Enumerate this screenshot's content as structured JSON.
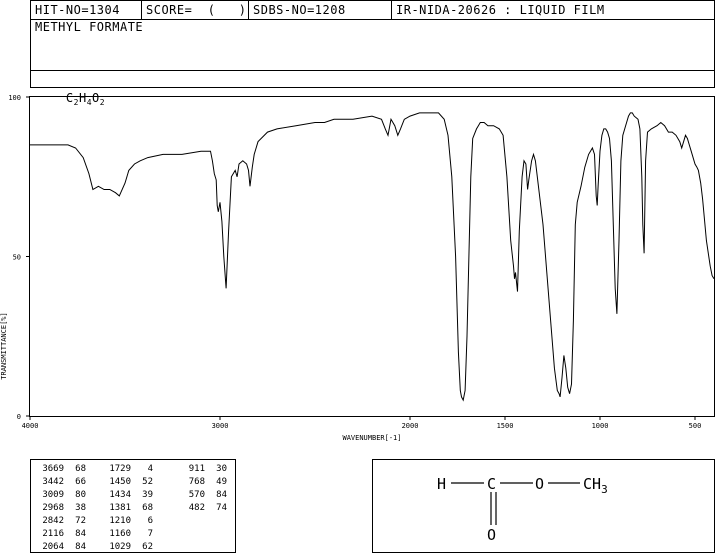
{
  "header": {
    "hit_no": "HIT-NO=1304",
    "score": "SCORE=  (   )",
    "sdbs_no": "SDBS-NO=1208",
    "ir_code": "IR-NIDA-20626 : LIQUID FILM",
    "compound_name": "METHYL FORMATE",
    "formula": {
      "c": "C",
      "c_n": "2",
      "h": "H",
      "h_n": "4",
      "o": "O",
      "o_n": "2"
    }
  },
  "chart_data": {
    "type": "line",
    "xlabel": "WAVENUMBER[-1]",
    "ylabel": "TRANSMITTANCE[%]",
    "xlim": [
      4000,
      400
    ],
    "ylim": [
      0,
      100
    ],
    "x_ticks": [
      4000,
      3000,
      2000,
      1500,
      1000,
      500
    ],
    "y_ticks": [
      0,
      50,
      100
    ],
    "x_tick_labels": [
      "4000",
      "3000",
      "2000",
      "1500",
      "1000",
      "500"
    ],
    "y_tick_labels": [
      "0",
      "50",
      "100"
    ],
    "series": [
      {
        "points": [
          [
            4000,
            85
          ],
          [
            3900,
            85
          ],
          [
            3800,
            85
          ],
          [
            3760,
            84
          ],
          [
            3720,
            81
          ],
          [
            3690,
            76
          ],
          [
            3669,
            71
          ],
          [
            3640,
            72
          ],
          [
            3610,
            71
          ],
          [
            3580,
            71
          ],
          [
            3550,
            70
          ],
          [
            3530,
            69
          ],
          [
            3500,
            73
          ],
          [
            3480,
            77
          ],
          [
            3450,
            79
          ],
          [
            3420,
            80
          ],
          [
            3380,
            81
          ],
          [
            3300,
            82
          ],
          [
            3200,
            82
          ],
          [
            3100,
            83
          ],
          [
            3050,
            83
          ],
          [
            3040,
            80
          ],
          [
            3030,
            76
          ],
          [
            3020,
            74
          ],
          [
            3015,
            66
          ],
          [
            3009,
            64
          ],
          [
            3000,
            67
          ],
          [
            2990,
            61
          ],
          [
            2980,
            50
          ],
          [
            2968,
            40
          ],
          [
            2955,
            58
          ],
          [
            2940,
            75
          ],
          [
            2920,
            77
          ],
          [
            2910,
            75
          ],
          [
            2900,
            79
          ],
          [
            2880,
            80
          ],
          [
            2860,
            79
          ],
          [
            2850,
            77
          ],
          [
            2842,
            72
          ],
          [
            2830,
            78
          ],
          [
            2820,
            82
          ],
          [
            2800,
            86
          ],
          [
            2750,
            89
          ],
          [
            2700,
            90
          ],
          [
            2600,
            91
          ],
          [
            2500,
            92
          ],
          [
            2450,
            92
          ],
          [
            2400,
            93
          ],
          [
            2300,
            93
          ],
          [
            2200,
            94
          ],
          [
            2150,
            93
          ],
          [
            2130,
            90
          ],
          [
            2116,
            88
          ],
          [
            2100,
            93
          ],
          [
            2080,
            91
          ],
          [
            2064,
            88
          ],
          [
            2050,
            90
          ],
          [
            2030,
            93
          ],
          [
            2000,
            94
          ],
          [
            1950,
            95
          ],
          [
            1900,
            95
          ],
          [
            1850,
            95
          ],
          [
            1820,
            93
          ],
          [
            1800,
            88
          ],
          [
            1780,
            75
          ],
          [
            1760,
            50
          ],
          [
            1745,
            20
          ],
          [
            1735,
            8
          ],
          [
            1729,
            6
          ],
          [
            1720,
            5
          ],
          [
            1710,
            8
          ],
          [
            1700,
            25
          ],
          [
            1690,
            50
          ],
          [
            1680,
            75
          ],
          [
            1670,
            87
          ],
          [
            1650,
            90
          ],
          [
            1630,
            92
          ],
          [
            1610,
            92
          ],
          [
            1590,
            91
          ],
          [
            1560,
            91
          ],
          [
            1530,
            90
          ],
          [
            1510,
            88
          ],
          [
            1490,
            75
          ],
          [
            1470,
            55
          ],
          [
            1455,
            47
          ],
          [
            1450,
            43
          ],
          [
            1445,
            45
          ],
          [
            1434,
            39
          ],
          [
            1425,
            58
          ],
          [
            1410,
            75
          ],
          [
            1400,
            80
          ],
          [
            1390,
            79
          ],
          [
            1381,
            71
          ],
          [
            1375,
            74
          ],
          [
            1360,
            80
          ],
          [
            1350,
            82
          ],
          [
            1340,
            80
          ],
          [
            1320,
            70
          ],
          [
            1300,
            60
          ],
          [
            1280,
            45
          ],
          [
            1260,
            30
          ],
          [
            1240,
            15
          ],
          [
            1225,
            8
          ],
          [
            1215,
            7
          ],
          [
            1210,
            6
          ],
          [
            1200,
            12
          ],
          [
            1190,
            19
          ],
          [
            1180,
            15
          ],
          [
            1170,
            9
          ],
          [
            1160,
            7
          ],
          [
            1150,
            10
          ],
          [
            1140,
            30
          ],
          [
            1130,
            60
          ],
          [
            1120,
            67
          ],
          [
            1100,
            72
          ],
          [
            1080,
            78
          ],
          [
            1060,
            82
          ],
          [
            1040,
            84
          ],
          [
            1029,
            82
          ],
          [
            1020,
            69
          ],
          [
            1015,
            66
          ],
          [
            1010,
            72
          ],
          [
            1000,
            83
          ],
          [
            990,
            88
          ],
          [
            980,
            90
          ],
          [
            970,
            90
          ],
          [
            960,
            89
          ],
          [
            950,
            87
          ],
          [
            940,
            80
          ],
          [
            930,
            60
          ],
          [
            920,
            40
          ],
          [
            911,
            32
          ],
          [
            900,
            55
          ],
          [
            890,
            80
          ],
          [
            880,
            88
          ],
          [
            860,
            92
          ],
          [
            850,
            94
          ],
          [
            840,
            95
          ],
          [
            830,
            95
          ],
          [
            820,
            94
          ],
          [
            800,
            93
          ],
          [
            790,
            90
          ],
          [
            780,
            75
          ],
          [
            775,
            60
          ],
          [
            768,
            51
          ],
          [
            760,
            80
          ],
          [
            750,
            89
          ],
          [
            730,
            90
          ],
          [
            700,
            91
          ],
          [
            680,
            92
          ],
          [
            660,
            91
          ],
          [
            640,
            89
          ],
          [
            620,
            89
          ],
          [
            600,
            88
          ],
          [
            590,
            87
          ],
          [
            580,
            86
          ],
          [
            570,
            84
          ],
          [
            560,
            86
          ],
          [
            550,
            88
          ],
          [
            540,
            87
          ],
          [
            530,
            85
          ],
          [
            520,
            83
          ],
          [
            500,
            79
          ],
          [
            490,
            78
          ],
          [
            482,
            77
          ],
          [
            470,
            73
          ],
          [
            460,
            68
          ],
          [
            440,
            55
          ],
          [
            420,
            47
          ],
          [
            410,
            44
          ],
          [
            400,
            43
          ]
        ]
      }
    ]
  },
  "peaks": {
    "columns": [
      [
        [
          "3669",
          "68"
        ],
        [
          "3442",
          "66"
        ],
        [
          "3009",
          "80"
        ],
        [
          "2968",
          "38"
        ],
        [
          "2842",
          "72"
        ],
        [
          "2116",
          "84"
        ],
        [
          "2064",
          "84"
        ]
      ],
      [
        [
          "1729",
          "4"
        ],
        [
          "1450",
          "52"
        ],
        [
          "1434",
          "39"
        ],
        [
          "1381",
          "68"
        ],
        [
          "1210",
          "6"
        ],
        [
          "1160",
          "7"
        ],
        [
          "1029",
          "62"
        ]
      ],
      [
        [
          "911",
          "30"
        ],
        [
          "768",
          "49"
        ],
        [
          "570",
          "84"
        ],
        [
          "482",
          "74"
        ]
      ]
    ]
  },
  "structure": {
    "h": "H",
    "c": "C",
    "o_ether": "O",
    "ch": "CH",
    "ch_sub": "3",
    "o_carbonyl": "O"
  }
}
